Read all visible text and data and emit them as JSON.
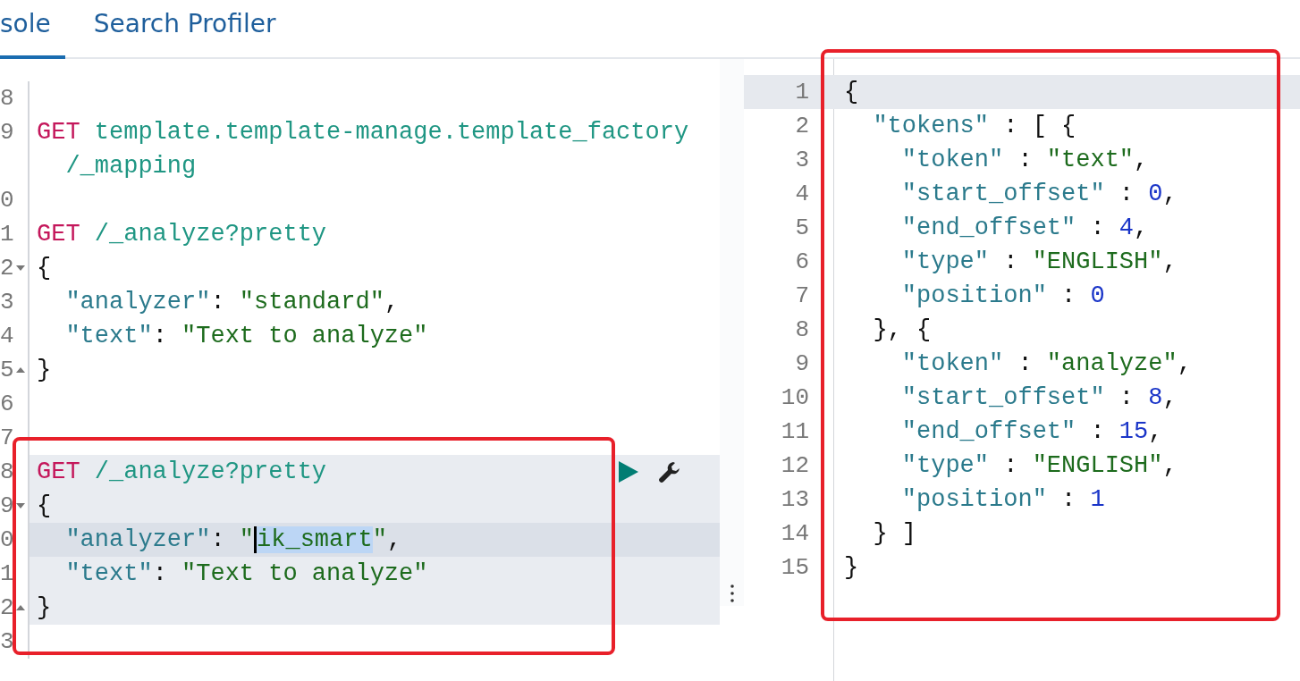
{
  "tabs": [
    {
      "label": "sole",
      "selected": true
    },
    {
      "label": "Search Profiler",
      "selected": false
    }
  ],
  "request_editor": {
    "rows": [
      {
        "number": "8",
        "selected": false,
        "current": false
      },
      {
        "number": "9",
        "selected": false,
        "current": false,
        "tokens": [
          {
            "kind": "method",
            "text": "GET "
          },
          {
            "kind": "url",
            "text": "template.template-manage.template_factory"
          }
        ]
      },
      {
        "selected": false,
        "current": false,
        "tokens": [
          {
            "kind": "url",
            "text": "  /_mapping"
          }
        ]
      },
      {
        "number": "0",
        "selected": false,
        "current": false
      },
      {
        "number": "1",
        "selected": false,
        "current": false,
        "tokens": [
          {
            "kind": "method",
            "text": "GET "
          },
          {
            "kind": "url",
            "text": "/_analyze?pretty"
          }
        ]
      },
      {
        "number": "2",
        "fold_start": true,
        "selected": false,
        "current": false,
        "tokens": [
          {
            "kind": "punct",
            "text": "{"
          }
        ]
      },
      {
        "number": "3",
        "selected": false,
        "current": false,
        "tokens": [
          {
            "kind": "key",
            "text": "  \"analyzer\""
          },
          {
            "kind": "punct",
            "text": ": "
          },
          {
            "kind": "string",
            "text": "\"standard\""
          },
          {
            "kind": "punct",
            "text": ","
          }
        ]
      },
      {
        "number": "4",
        "selected": false,
        "current": false,
        "tokens": [
          {
            "kind": "key",
            "text": "  \"text\""
          },
          {
            "kind": "punct",
            "text": ": "
          },
          {
            "kind": "string",
            "text": "\"Text to analyze\""
          }
        ]
      },
      {
        "number": "5",
        "fold_end": true,
        "selected": false,
        "current": false,
        "tokens": [
          {
            "kind": "punct",
            "text": "}"
          }
        ]
      },
      {
        "number": "6",
        "selected": false,
        "current": false
      },
      {
        "number": "7",
        "selected": false,
        "current": false
      },
      {
        "number": "8",
        "selected": true,
        "current": false,
        "actions": true,
        "tokens": [
          {
            "kind": "method",
            "text": "GET "
          },
          {
            "kind": "url",
            "text": "/_analyze?pretty"
          }
        ]
      },
      {
        "number": "9",
        "fold_start": true,
        "selected": true,
        "current": false,
        "tokens": [
          {
            "kind": "punct",
            "text": "{"
          }
        ]
      },
      {
        "number": "0",
        "selected": true,
        "current": true,
        "tokens": [
          {
            "kind": "key",
            "text": "  \"analyzer\""
          },
          {
            "kind": "punct",
            "text": ": "
          },
          {
            "kind": "string",
            "text": "\""
          },
          {
            "kind": "selection",
            "text": "ik_smart"
          },
          {
            "kind": "string",
            "text": "\""
          },
          {
            "kind": "punct",
            "text": ","
          }
        ]
      },
      {
        "number": "1",
        "selected": true,
        "current": false,
        "tokens": [
          {
            "kind": "key",
            "text": "  \"text\""
          },
          {
            "kind": "punct",
            "text": ": "
          },
          {
            "kind": "string",
            "text": "\"Text to analyze\""
          }
        ]
      },
      {
        "number": "2",
        "fold_end": true,
        "selected": true,
        "current": false,
        "tokens": [
          {
            "kind": "punct",
            "text": "}"
          }
        ]
      },
      {
        "number": "3",
        "selected": false,
        "current": false
      }
    ]
  },
  "response_viewer": {
    "rows": [
      {
        "number": "1",
        "current": true,
        "tokens": [
          {
            "kind": "punct",
            "text": "{"
          }
        ]
      },
      {
        "number": "2",
        "current": false,
        "tokens": [
          {
            "kind": "key",
            "text": "  \"tokens\""
          },
          {
            "kind": "punct",
            "text": " : [ {"
          }
        ]
      },
      {
        "number": "3",
        "current": false,
        "tokens": [
          {
            "kind": "key",
            "text": "    \"token\""
          },
          {
            "kind": "punct",
            "text": " : "
          },
          {
            "kind": "string",
            "text": "\"text\""
          },
          {
            "kind": "punct",
            "text": ","
          }
        ]
      },
      {
        "number": "4",
        "current": false,
        "tokens": [
          {
            "kind": "key",
            "text": "    \"start_offset\""
          },
          {
            "kind": "punct",
            "text": " : "
          },
          {
            "kind": "number",
            "text": "0"
          },
          {
            "kind": "punct",
            "text": ","
          }
        ]
      },
      {
        "number": "5",
        "current": false,
        "tokens": [
          {
            "kind": "key",
            "text": "    \"end_offset\""
          },
          {
            "kind": "punct",
            "text": " : "
          },
          {
            "kind": "number",
            "text": "4"
          },
          {
            "kind": "punct",
            "text": ","
          }
        ]
      },
      {
        "number": "6",
        "current": false,
        "tokens": [
          {
            "kind": "key",
            "text": "    \"type\""
          },
          {
            "kind": "punct",
            "text": " : "
          },
          {
            "kind": "string",
            "text": "\"ENGLISH\""
          },
          {
            "kind": "punct",
            "text": ","
          }
        ]
      },
      {
        "number": "7",
        "current": false,
        "tokens": [
          {
            "kind": "key",
            "text": "    \"position\""
          },
          {
            "kind": "punct",
            "text": " : "
          },
          {
            "kind": "number",
            "text": "0"
          }
        ]
      },
      {
        "number": "8",
        "current": false,
        "tokens": [
          {
            "kind": "punct",
            "text": "  }, {"
          }
        ]
      },
      {
        "number": "9",
        "current": false,
        "tokens": [
          {
            "kind": "key",
            "text": "    \"token\""
          },
          {
            "kind": "punct",
            "text": " : "
          },
          {
            "kind": "string",
            "text": "\"analyze\""
          },
          {
            "kind": "punct",
            "text": ","
          }
        ]
      },
      {
        "number": "10",
        "current": false,
        "tokens": [
          {
            "kind": "key",
            "text": "    \"start_offset\""
          },
          {
            "kind": "punct",
            "text": " : "
          },
          {
            "kind": "number",
            "text": "8"
          },
          {
            "kind": "punct",
            "text": ","
          }
        ]
      },
      {
        "number": "11",
        "current": false,
        "tokens": [
          {
            "kind": "key",
            "text": "    \"end_offset\""
          },
          {
            "kind": "punct",
            "text": " : "
          },
          {
            "kind": "number",
            "text": "15"
          },
          {
            "kind": "punct",
            "text": ","
          }
        ]
      },
      {
        "number": "12",
        "current": false,
        "tokens": [
          {
            "kind": "key",
            "text": "    \"type\""
          },
          {
            "kind": "punct",
            "text": " : "
          },
          {
            "kind": "string",
            "text": "\"ENGLISH\""
          },
          {
            "kind": "punct",
            "text": ","
          }
        ]
      },
      {
        "number": "13",
        "current": false,
        "tokens": [
          {
            "kind": "key",
            "text": "    \"position\""
          },
          {
            "kind": "punct",
            "text": " : "
          },
          {
            "kind": "number",
            "text": "1"
          }
        ]
      },
      {
        "number": "14",
        "current": false,
        "tokens": [
          {
            "kind": "punct",
            "text": "  } ]"
          }
        ]
      },
      {
        "number": "15",
        "current": false,
        "tokens": [
          {
            "kind": "punct",
            "text": "}"
          }
        ]
      }
    ]
  }
}
